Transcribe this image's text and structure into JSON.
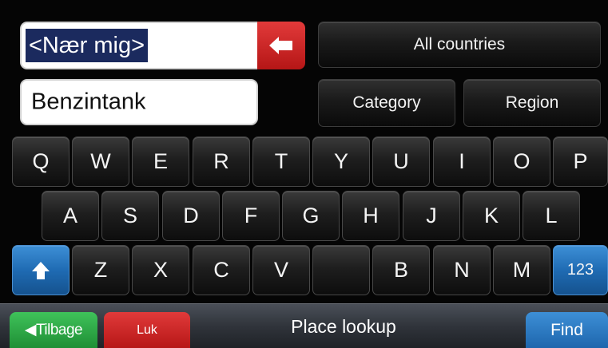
{
  "search": {
    "location_value": "<Nær mig>",
    "category_value": "Benzintank"
  },
  "buttons": {
    "all_countries": "All countries",
    "category": "Category",
    "region": "Region"
  },
  "keyboard": {
    "row1": [
      "Q",
      "W",
      "E",
      "R",
      "T",
      "Y",
      "U",
      "I",
      "O",
      "P"
    ],
    "row2": [
      "A",
      "S",
      "D",
      "F",
      "G",
      "H",
      "J",
      "K",
      "L"
    ],
    "row3": [
      "Z",
      "X",
      "C",
      "V",
      "",
      "B",
      "N",
      "M"
    ],
    "numbers_label": "123"
  },
  "bottom": {
    "back_label": "◀Tilbage",
    "close_label": "Luk",
    "title": "Place lookup",
    "find_label": "Find"
  },
  "icons": {
    "backspace": "backspace-icon",
    "shift": "shift-arrow-icon"
  },
  "colors": {
    "selection": "#1b2a5e",
    "backspace": "#c82020",
    "back_button": "#2aa845",
    "close_button": "#c42020",
    "accent_blue": "#1f6bb3"
  }
}
